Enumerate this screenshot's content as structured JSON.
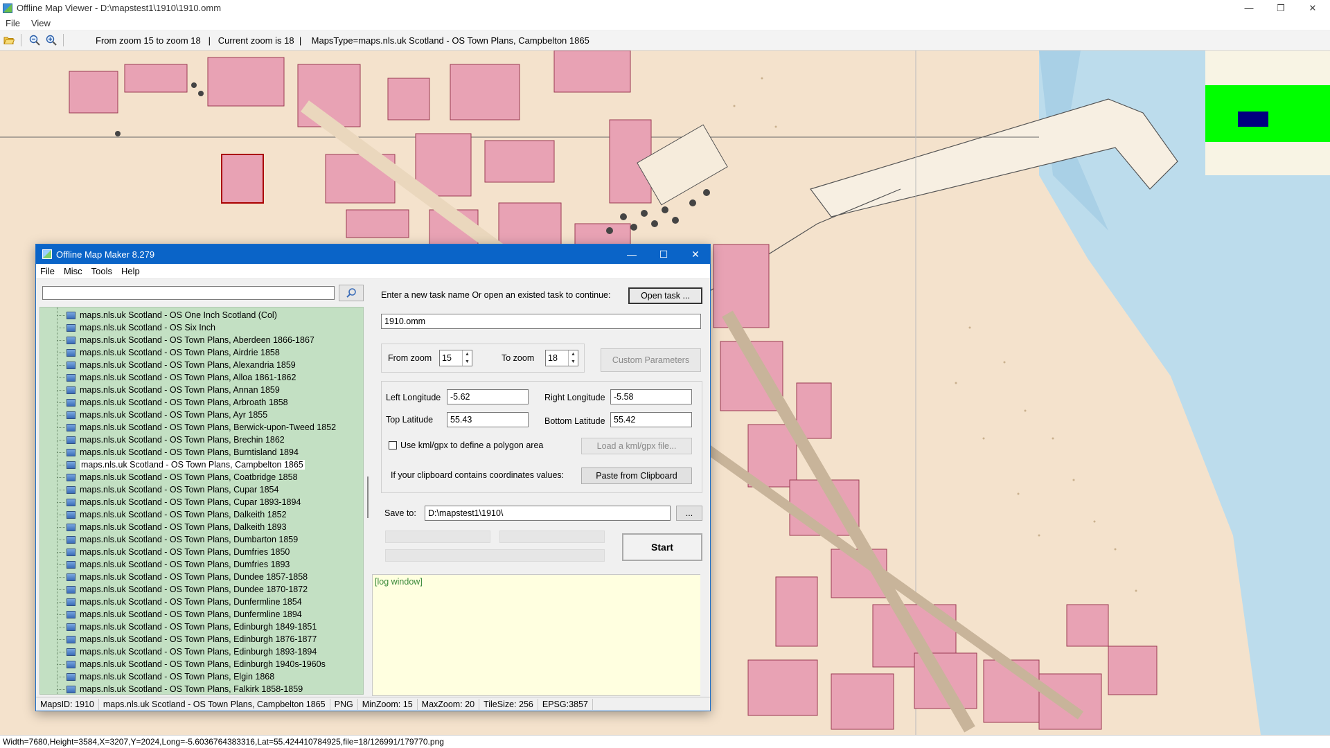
{
  "viewer": {
    "title": "Offline Map Viewer - D:\\mapstest1\\1910\\1910.omm",
    "controls": {
      "minimize": "—",
      "restore": "❐",
      "close": "✕"
    },
    "menu": [
      "File",
      "View"
    ],
    "toolbar": {
      "status_text": "From zoom 15 to zoom 18   |   Current zoom is 18  |    MapsType=maps.nls.uk Scotland - OS Town Plans, Campbelton 1865"
    },
    "status_bar": "Width=7680,Height=3584,X=3207,Y=2024,Long=-5.6036764383316,Lat=55.424410784925,file=18/126991/179770.png"
  },
  "dialog": {
    "title": "Offline Map Maker 8.279",
    "controls": {
      "minimize": "—",
      "maximize": "☐",
      "close": "✕"
    },
    "menu": [
      "File",
      "Misc",
      "Tools",
      "Help"
    ],
    "search": {
      "value": "",
      "placeholder": ""
    },
    "map_list": [
      "maps.nls.uk Scotland - OS One Inch Scotland (Col)",
      "maps.nls.uk Scotland - OS Six Inch",
      "maps.nls.uk Scotland - OS Town Plans, Aberdeen 1866-1867",
      "maps.nls.uk Scotland - OS Town Plans, Airdrie 1858",
      "maps.nls.uk Scotland - OS Town Plans, Alexandria 1859",
      "maps.nls.uk Scotland - OS Town Plans, Alloa 1861-1862",
      "maps.nls.uk Scotland - OS Town Plans, Annan 1859",
      "maps.nls.uk Scotland - OS Town Plans, Arbroath 1858",
      "maps.nls.uk Scotland - OS Town Plans, Ayr 1855",
      "maps.nls.uk Scotland - OS Town Plans, Berwick-upon-Tweed 1852",
      "maps.nls.uk Scotland - OS Town Plans, Brechin 1862",
      "maps.nls.uk Scotland - OS Town Plans, Burntisland 1894",
      "maps.nls.uk Scotland - OS Town Plans, Campbelton 1865",
      "maps.nls.uk Scotland - OS Town Plans, Coatbridge 1858",
      "maps.nls.uk Scotland - OS Town Plans, Cupar 1854",
      "maps.nls.uk Scotland - OS Town Plans, Cupar 1893-1894",
      "maps.nls.uk Scotland - OS Town Plans, Dalkeith 1852",
      "maps.nls.uk Scotland - OS Town Plans, Dalkeith 1893",
      "maps.nls.uk Scotland - OS Town Plans, Dumbarton 1859",
      "maps.nls.uk Scotland - OS Town Plans, Dumfries 1850",
      "maps.nls.uk Scotland - OS Town Plans, Dumfries 1893",
      "maps.nls.uk Scotland - OS Town Plans, Dundee 1857-1858",
      "maps.nls.uk Scotland - OS Town Plans, Dundee 1870-1872",
      "maps.nls.uk Scotland - OS Town Plans, Dunfermline 1854",
      "maps.nls.uk Scotland - OS Town Plans, Dunfermline 1894",
      "maps.nls.uk Scotland - OS Town Plans, Edinburgh 1849-1851",
      "maps.nls.uk Scotland - OS Town Plans, Edinburgh 1876-1877",
      "maps.nls.uk Scotland - OS Town Plans, Edinburgh 1893-1894",
      "maps.nls.uk Scotland - OS Town Plans, Edinburgh 1940s-1960s",
      "maps.nls.uk Scotland - OS Town Plans, Elgin 1868",
      "maps.nls.uk Scotland - OS Town Plans, Falkirk 1858-1859"
    ],
    "selected_index": 12,
    "task_prompt": "Enter a new task name Or open an existed task to continue:",
    "open_task_label": "Open task ...",
    "task_name": "1910.omm",
    "from_zoom_label": "From zoom",
    "from_zoom": "15",
    "to_zoom_label": "To zoom",
    "to_zoom": "18",
    "custom_params_label": "Custom Parameters",
    "left_longitude_label": "Left Longitude",
    "left_longitude": "-5.62",
    "right_longitude_label": "Right Longitude",
    "right_longitude": "-5.58",
    "top_latitude_label": "Top Latitude",
    "top_latitude": "55.43",
    "bottom_latitude_label": "Bottom Latitude",
    "bottom_latitude": "55.42",
    "kml_label": "Use kml/gpx to define a polygon area",
    "load_kml_label": "Load a kml/gpx file...",
    "clipboard_prompt": "If your clipboard contains coordinates values:",
    "paste_label": "Paste from Clipboard",
    "save_to_label": "Save to:",
    "save_to": "D:\\mapstest1\\1910\\",
    "browse_label": "...",
    "start_label": "Start",
    "log_text": "[log window]",
    "status": {
      "maps_id": "MapsID: 1910",
      "map_name": "maps.nls.uk Scotland - OS Town Plans, Campbelton 1865",
      "format": "PNG",
      "min_zoom": "MinZoom: 15",
      "max_zoom": "MaxZoom: 20",
      "tile_size": "TileSize: 256",
      "epsg": "EPSG:3857"
    }
  },
  "colors": {
    "map_paper": "#f4e2cc",
    "building": "#e8a2b4",
    "sea": "#bcdcec",
    "minimap_green": "#00ff00",
    "minimap_marker": "#000080",
    "list_bg": "#c3e0c3",
    "log_bg": "#ffffe0",
    "dialog_title": "#0a64c8"
  },
  "icons": {
    "open": "folder-open-icon",
    "zoom_out": "zoom-out-icon",
    "zoom_in": "zoom-in-icon",
    "search": "magnifier-icon"
  }
}
